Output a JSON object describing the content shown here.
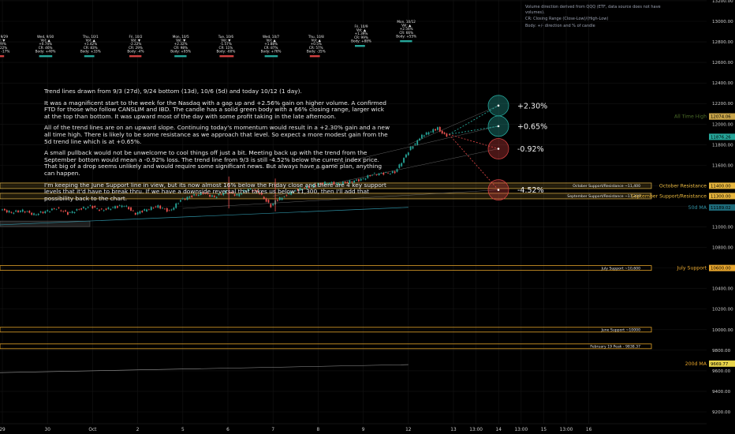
{
  "header": {
    "source_note": "Volume direction derived from QQQ (ETF, data source does not have volumes).",
    "legend_line1": "CR: Closing Range (Close-Low)/(High-Low)",
    "legend_line2": "Body: +/- direction and % of candle"
  },
  "commentary": {
    "p1": "Trend lines drawn from 9/3 (27d), 9/24 bottom (13d), 10/6 (5d) and today 10/12 (1 day).",
    "p2": "It was a magnificent start to the week for the Nasdaq with a gap up and +2.56% gain on higher volume. A confirmed FTD for those who follow CANSLIM and IBD. The candle has a solid green body with a 66% closing range, larger wick at the top than bottom. It was upward most of the day with some profit taking in the late afternoon.",
    "p3": "All of the trend lines are on an upward slope. Continuing today's momentum would result in a +2.30% gain and a new all time high. There is likely to be some resistance as we approach that level. So expect a more modest gain from the 5d trend line which is at +0.65%.",
    "p4": "A small pullback would not be unwelcome to cool things off just a bit. Meeting back up with the trend from the September bottom would mean a -0.92% loss. The trend line from 9/3 is still -4.52% below the current index price. That big of a drop seems unlikely and would require some significant news. But always have a game plan, anything can happen.",
    "p5": "I'm keeping the June Support line in view, but its now almost 16% below the Friday close and there are 4 key support levels that it'd have to break thru.  If we have a downside reversal that takes us below 11,300, then I'll add that possibility back to the chart."
  },
  "chart_data": {
    "type": "candlestick",
    "title": "",
    "xlabel": "",
    "ylabel": "",
    "y_range": [
      9130,
      13320
    ],
    "y_ticks": [
      9200,
      9400,
      9600,
      9800,
      10000,
      10200,
      10400,
      10600,
      10800,
      11000,
      11200,
      11400,
      11600,
      11800,
      12000,
      12200,
      12400,
      12600,
      12800,
      13000,
      13200
    ],
    "y_tick_labels": [
      "9200.00",
      "9400.00",
      "9600.00",
      "9800.00",
      "10000.00",
      "10200.00",
      "10400.00",
      "10600.00",
      "10800.00",
      "11000.00",
      "11200.00",
      "11400.00",
      "11600.00",
      "11800.00",
      "12000.00",
      "12200.00",
      "12400.00",
      "12600.00",
      "12800.00",
      "13000.00",
      "13200.00"
    ],
    "x_ticks": [
      {
        "label": "29",
        "day": 0
      },
      {
        "label": "30",
        "day": 1
      },
      {
        "label": "Oct",
        "day": 2
      },
      {
        "label": "2",
        "day": 3
      },
      {
        "label": "5",
        "day": 4
      },
      {
        "label": "6",
        "day": 5
      },
      {
        "label": "7",
        "day": 6
      },
      {
        "label": "8",
        "day": 7
      },
      {
        "label": "9",
        "day": 8
      },
      {
        "label": "12",
        "day": 9
      },
      {
        "label": "13",
        "day": 10
      },
      {
        "label": "13:00",
        "day": 10.5
      },
      {
        "label": "14",
        "day": 11
      },
      {
        "label": "13:00",
        "day": 11.5
      },
      {
        "label": "15",
        "day": 12
      },
      {
        "label": "13:00",
        "day": 12.5
      },
      {
        "label": "16",
        "day": 13
      }
    ],
    "price_series": [
      [
        0.0,
        11170
      ],
      [
        0.25,
        11140
      ],
      [
        0.5,
        11160
      ],
      [
        0.75,
        11120
      ],
      [
        1.0,
        11150
      ],
      [
        1.25,
        11180
      ],
      [
        1.5,
        11130
      ],
      [
        1.75,
        11170
      ],
      [
        2.0,
        11200
      ],
      [
        2.25,
        11160
      ],
      [
        2.5,
        11190
      ],
      [
        2.75,
        11210
      ],
      [
        3.0,
        11130
      ],
      [
        3.25,
        11170
      ],
      [
        3.5,
        11200
      ],
      [
        3.75,
        11150
      ],
      [
        4.0,
        11260
      ],
      [
        4.25,
        11300
      ],
      [
        4.5,
        11330
      ],
      [
        4.75,
        11290
      ],
      [
        5.0,
        11340
      ],
      [
        5.25,
        11310
      ],
      [
        5.5,
        11370
      ],
      [
        5.75,
        11330
      ],
      [
        6.0,
        11200
      ],
      [
        6.1,
        11250
      ],
      [
        6.3,
        11300
      ],
      [
        6.5,
        11350
      ],
      [
        6.75,
        11380
      ],
      [
        7.0,
        11410
      ],
      [
        7.25,
        11430
      ],
      [
        7.5,
        11420
      ],
      [
        7.75,
        11440
      ],
      [
        8.0,
        11460
      ],
      [
        8.25,
        11510
      ],
      [
        8.5,
        11520
      ],
      [
        8.75,
        11530
      ],
      [
        9.0,
        11700
      ],
      [
        9.1,
        11770
      ],
      [
        9.2,
        11810
      ],
      [
        9.3,
        11870
      ],
      [
        9.4,
        11900
      ],
      [
        9.5,
        11920
      ],
      [
        9.6,
        11940
      ],
      [
        9.7,
        11960
      ],
      [
        9.8,
        11910
      ],
      [
        9.9,
        11890
      ]
    ],
    "levels": [
      {
        "name": "October Support/Resistance ~11,400",
        "value": 11400,
        "color": "#e5b84a"
      },
      {
        "name": "September Support/Resistance ~11,300",
        "value": 11300,
        "color": "#e5b84a"
      },
      {
        "name": "July Support ~10,600",
        "value": 10600,
        "color": "#e5a52a"
      },
      {
        "name": "June Support ~10000",
        "value": 10000,
        "color": "#e5a52a"
      },
      {
        "name": "February 19 Peak - 9838.37",
        "value": 9838.37,
        "color": "#e5a52a"
      }
    ],
    "axis_badges": [
      {
        "label": "All Time High",
        "value": 12074.06,
        "price": "12074.06",
        "bg": "#d7a73a",
        "text_color": "#555a00"
      },
      {
        "label": "October Resistance",
        "value": 11400,
        "price": "11400.00",
        "bg": "#e6b53d",
        "text_color": "#e6b53d"
      },
      {
        "label": "September Support/Resistance",
        "value": 11300,
        "price": "11300.00",
        "bg": "#e6b53d",
        "text_color": "#e6b53d"
      },
      {
        "label": "",
        "value": 11189,
        "price": "11189.02",
        "bg": "#0b3b46",
        "text_color": "#0b3b46"
      },
      {
        "label": "July Support",
        "value": 10600,
        "price": "10600.00",
        "bg": "#e6a52d",
        "text_color": "#e6a52d"
      }
    ],
    "current_badges": [
      {
        "label": "All Time High",
        "value": 12074.06,
        "price": "12074.06",
        "bg": "#c9a54a",
        "text_color": "#3a5a2a"
      },
      {
        "label": "",
        "value": 11876.26,
        "price": "11876.26",
        "bg": "#26a69a",
        "text_color": "#26a69a"
      },
      {
        "label": "50d MA",
        "value": 11189.02,
        "price": "11189.02",
        "bg": "#1e6b7a",
        "text_color": "#2e8fa2"
      },
      {
        "label": "200d MA",
        "value": 9669.77,
        "price": "9669.77",
        "bg": "#e8d44a",
        "text_color": "#e8a52a"
      }
    ],
    "projections": [
      {
        "label": "+2.30%",
        "value": 12180,
        "color": "#26a69a"
      },
      {
        "label": "+0.65%",
        "value": 11980,
        "color": "#26a69a"
      },
      {
        "label": "-0.92%",
        "value": 11760,
        "color": "#d04040"
      },
      {
        "label": "-4.52%",
        "value": 11360,
        "color": "#d04040"
      }
    ],
    "ma_50": [
      [
        -0.3,
        11070
      ],
      [
        9.0,
        11200
      ]
    ],
    "ma_200": [
      [
        -0.3,
        9580
      ],
      [
        9.0,
        9660
      ]
    ],
    "daily_stats": [
      {
        "date": "Tue, 9/29",
        "vol": "Vol: ▼",
        "pct": "-0.29%",
        "cr": "CR: 22%",
        "body": "Body: -17%",
        "dir": "down",
        "volbar": 1.0
      },
      {
        "date": "Wed, 9/30",
        "vol": "Vol: ▲",
        "pct": "+0.74%",
        "cr": "CR: 46%",
        "body": "Body: +40%",
        "dir": "up",
        "volbar": 1.3
      },
      {
        "date": "Thu, 10/1",
        "vol": "Vol: ▲",
        "pct": "+1.42%",
        "cr": "CR: 83%",
        "body": "Body: +33%",
        "dir": "up",
        "volbar": 1.0
      },
      {
        "date": "Fri, 10/2",
        "vol": "Vol: ▼",
        "pct": "-2.22%",
        "cr": "CR: 29%",
        "body": "Body: -4%",
        "dir": "down",
        "volbar": 1.2
      },
      {
        "date": "Mon, 10/5",
        "vol": "Vol: ▼",
        "pct": "+2.32%",
        "cr": "CR: 98%",
        "body": "Body: +95%",
        "dir": "up",
        "volbar": 1.2
      },
      {
        "date": "Tue, 10/6",
        "vol": "Vol: ▼",
        "pct": "-1.57%",
        "cr": "CR: 11%",
        "body": "Body: -60%",
        "dir": "down",
        "volbar": 1.4
      },
      {
        "date": "Wed, 10/7",
        "vol": "Vol: ▲",
        "pct": "+1.88%",
        "cr": "CR: 87%",
        "body": "Body: +76%",
        "dir": "up",
        "volbar": 1.3
      },
      {
        "date": "Thu, 10/8",
        "vol": "Vol: ▲",
        "pct": "+0.5%",
        "cr": "CR: 57%",
        "body": "Body: -35%",
        "dir": "down",
        "volbar": 1.0
      },
      {
        "date": "Fri, 10/9",
        "vol": "Vol: ▲",
        "pct": "+1.39%",
        "cr": "CR: 99%",
        "body": "Body: +88%",
        "dir": "up",
        "volbar": 1.0
      },
      {
        "date": "Mon, 10/12",
        "vol": "Vol: ▲",
        "pct": "+2.56%",
        "cr": "CR: 66%",
        "body": "Body: +55%",
        "dir": "up",
        "volbar": 1.2
      }
    ]
  }
}
